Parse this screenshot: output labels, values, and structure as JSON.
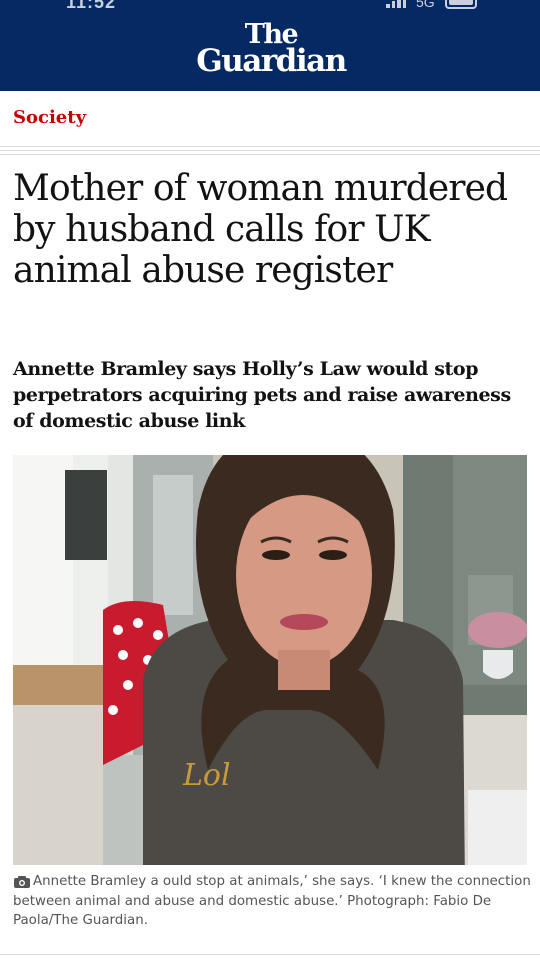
{
  "status_bar": {
    "time": "11:52",
    "network": "5G"
  },
  "header": {
    "masthead_line1": "The",
    "masthead_line2": "Guardian"
  },
  "article": {
    "section": "Society",
    "headline": "Mother of woman murdered by husband calls for UK animal abuse register",
    "standfirst": "Annette Bramley says Holly’s Law would stop perpetrators acquiring pets and raise awareness of domestic abuse link",
    "caption": "Annette Bramley a                                                        ould stop at animals,’ she says. ‘I knew the connection between animal and abuse and domestic abuse.’ Photograph: Fabio De Paola/The Guardian."
  },
  "colors": {
    "brand": "#052962",
    "section": "#c70000",
    "text": "#121212",
    "caption": "#555555"
  },
  "icons": {
    "caption": "camera-icon",
    "signal": "signal-icon",
    "battery": "battery-icon"
  }
}
